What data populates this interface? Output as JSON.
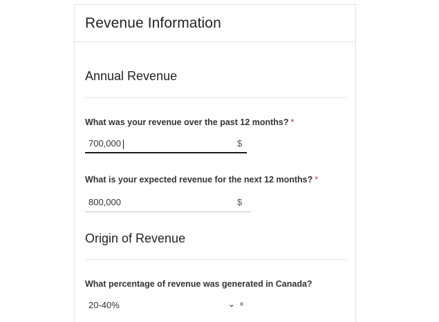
{
  "card": {
    "title": "Revenue Information"
  },
  "annual_revenue": {
    "title": "Annual Revenue",
    "past_12_months": {
      "label": "What was your revenue over the past 12 months?",
      "required_marker": "*",
      "value": "700,000",
      "unit": "$"
    },
    "next_12_months": {
      "label": "What is your expected revenue for the next 12 months?",
      "required_marker": "*",
      "value": "800,000",
      "unit": "$"
    }
  },
  "origin_of_revenue": {
    "title": "Origin of Revenue",
    "canada_percentage": {
      "label": "What percentage of revenue was generated in Canada?",
      "selected_value": "20-40%",
      "chevron_icon": "chevron-down-icon",
      "clear_icon": "close-icon"
    }
  }
}
